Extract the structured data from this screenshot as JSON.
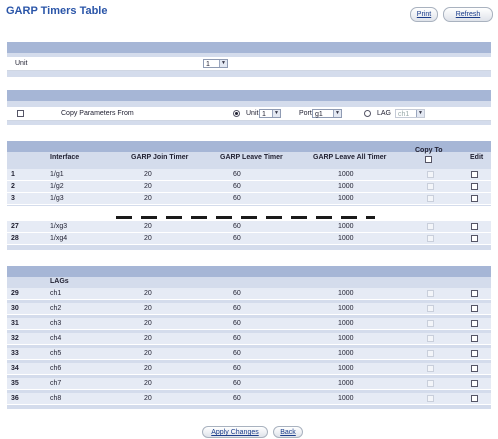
{
  "page": {
    "title": "GARP Timers Table"
  },
  "toolbar": {
    "print_label": "Print",
    "refresh_label": "Refresh"
  },
  "unit_panel": {
    "label": "Unit",
    "value": "1"
  },
  "copy_panel": {
    "label": "Copy Parameters From",
    "unit_label": "Unit",
    "unit_value": "1",
    "port_label": "Port",
    "port_value": "g1",
    "lag_label": "LAG",
    "lag_value": "ch1",
    "selected_source": "Unit"
  },
  "table": {
    "headers": {
      "interface": "Interface",
      "join": "GARP Join Timer",
      "leave": "GARP Leave Timer",
      "leave_all": "GARP Leave All Timer",
      "copy_to": "Copy To",
      "edit": "Edit"
    },
    "rows": [
      {
        "num": "1",
        "interface": "1/g1",
        "join": "20",
        "leave": "60",
        "leave_all": "1000"
      },
      {
        "num": "2",
        "interface": "1/g2",
        "join": "20",
        "leave": "60",
        "leave_all": "1000"
      },
      {
        "num": "3",
        "interface": "1/g3",
        "join": "20",
        "leave": "60",
        "leave_all": "1000"
      },
      {
        "num": "27",
        "interface": "1/xg3",
        "join": "20",
        "leave": "60",
        "leave_all": "1000"
      },
      {
        "num": "28",
        "interface": "1/xg4",
        "join": "20",
        "leave": "60",
        "leave_all": "1000"
      }
    ]
  },
  "lags": {
    "header": "LAGs",
    "rows": [
      {
        "num": "29",
        "interface": "ch1",
        "join": "20",
        "leave": "60",
        "leave_all": "1000"
      },
      {
        "num": "30",
        "interface": "ch2",
        "join": "20",
        "leave": "60",
        "leave_all": "1000"
      },
      {
        "num": "31",
        "interface": "ch3",
        "join": "20",
        "leave": "60",
        "leave_all": "1000"
      },
      {
        "num": "32",
        "interface": "ch4",
        "join": "20",
        "leave": "60",
        "leave_all": "1000"
      },
      {
        "num": "33",
        "interface": "ch5",
        "join": "20",
        "leave": "60",
        "leave_all": "1000"
      },
      {
        "num": "34",
        "interface": "ch6",
        "join": "20",
        "leave": "60",
        "leave_all": "1000"
      },
      {
        "num": "35",
        "interface": "ch7",
        "join": "20",
        "leave": "60",
        "leave_all": "1000"
      },
      {
        "num": "36",
        "interface": "ch8",
        "join": "20",
        "leave": "60",
        "leave_all": "1000"
      }
    ]
  },
  "footer": {
    "apply_label": "Apply Changes",
    "back_label": "Back"
  }
}
